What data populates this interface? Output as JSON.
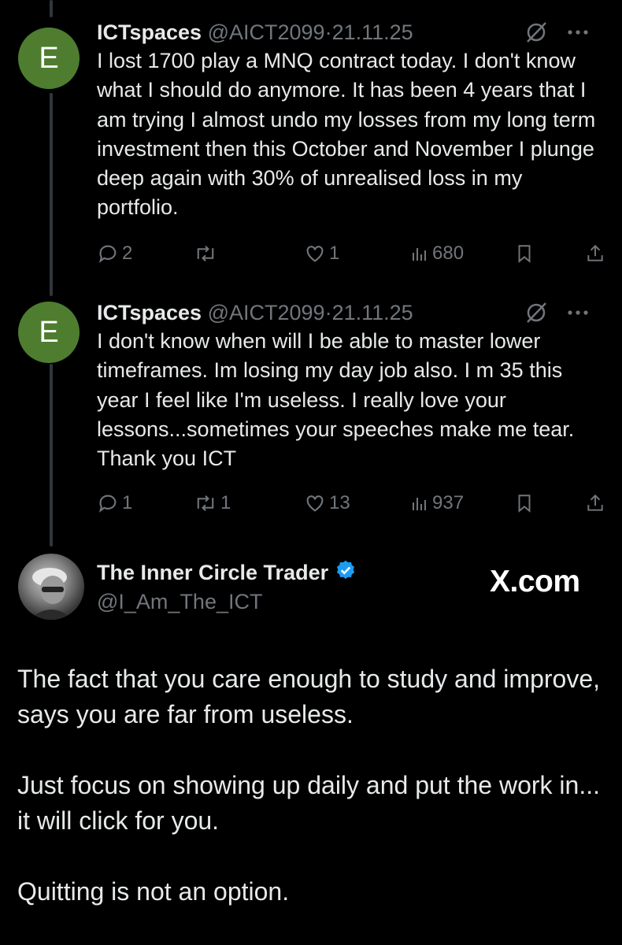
{
  "tweets": [
    {
      "avatar_letter": "E",
      "name": "ICTspaces",
      "handle": "@AICT2099",
      "date": "21.11.25",
      "text": "I lost 1700 play a MNQ contract today. I don't know what I should do anymore. It has been 4 years that I am trying I almost undo my losses from my long term investment then this October and November I plunge deep again with 30% of unrealised loss in my portfolio.",
      "replies": "2",
      "retweets": "",
      "likes": "1",
      "views": "680"
    },
    {
      "avatar_letter": "E",
      "name": "ICTspaces",
      "handle": "@AICT2099",
      "date": "21.11.25",
      "text": "I don't know when will I be able to master lower timeframes. Im losing my day job also. I m 35 this year I feel like I'm useless. I really love your lessons...sometimes your speeches make me tear. Thank you ICT",
      "replies": "1",
      "retweets": "1",
      "likes": "13",
      "views": "937"
    }
  ],
  "reply_author": {
    "name": "The Inner Circle Trader",
    "handle": "@I_Am_The_ICT",
    "verified": true
  },
  "watermark": "X.com",
  "reply_paragraphs": [
    "The fact that you care enough to study and improve, says you are far from useless.",
    "Just focus on showing up daily and put the work in... it will click for you.",
    "Quitting is not an option."
  ],
  "colors": {
    "background": "#000000",
    "text": "#e7e9ea",
    "muted": "#71767b",
    "avatar_green": "#4e7d2f",
    "verified_blue": "#1d9bf0"
  },
  "icons": [
    "grok-icon",
    "more-icon",
    "reply-icon",
    "retweet-icon",
    "like-icon",
    "views-icon",
    "bookmark-icon",
    "share-icon",
    "verified-badge-icon"
  ]
}
